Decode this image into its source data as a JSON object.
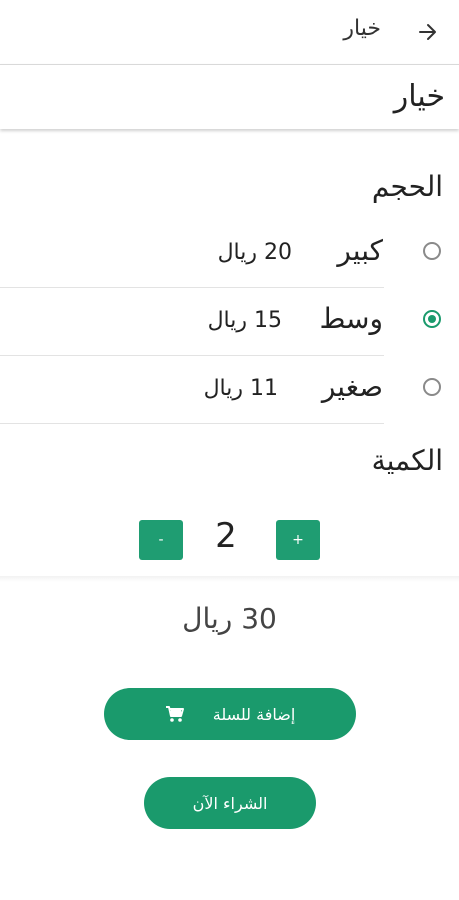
{
  "header": {
    "title": "خيار",
    "back_icon": "arrow-right-icon"
  },
  "option": {
    "title": "خيار"
  },
  "size": {
    "title": "الحجم",
    "options": [
      {
        "name": "كبير",
        "price": "20 ريال",
        "selected": false
      },
      {
        "name": "وسط",
        "price": "15 ريال",
        "selected": true
      },
      {
        "name": "صغير",
        "price": "11 ريال",
        "selected": false
      }
    ]
  },
  "quantity": {
    "title": "الكمية",
    "value": "2",
    "decrease_label": "-",
    "increase_label": "+"
  },
  "total": {
    "text": "30 ريال"
  },
  "actions": {
    "add_to_cart_label": "إضافة للسلة",
    "cart_icon": "cart-icon",
    "buy_now_label": "الشراء الآن"
  },
  "colors": {
    "accent": "#1a9a6c"
  }
}
